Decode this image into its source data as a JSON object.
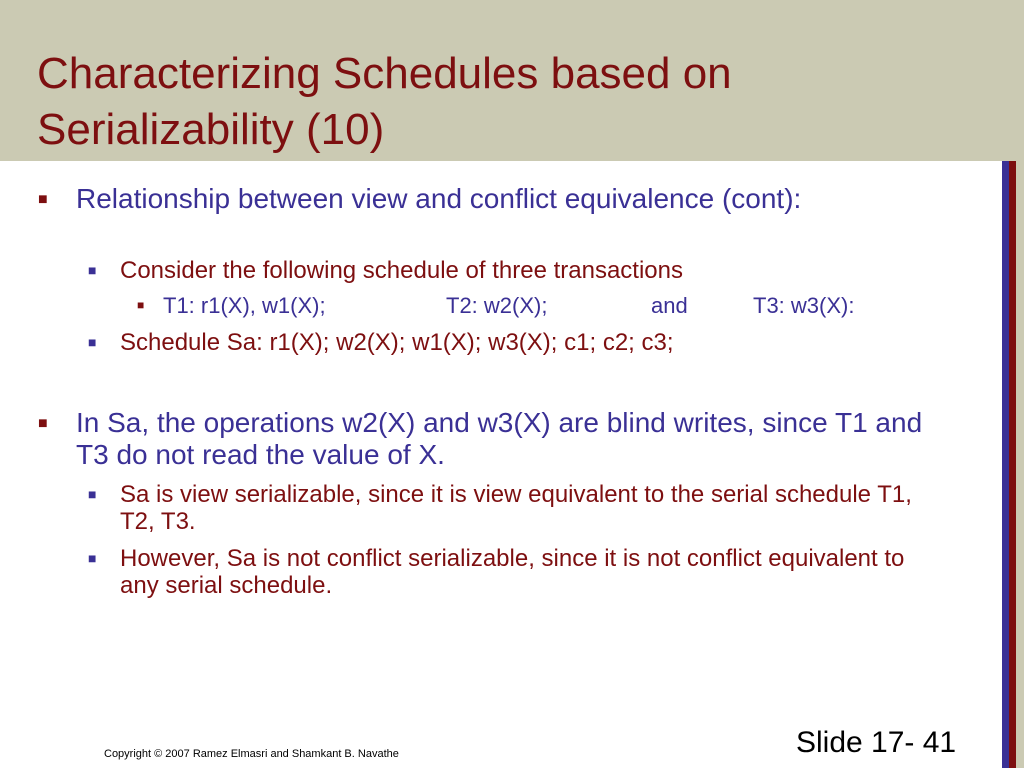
{
  "title": "Characterizing Schedules based on Serializability (10)",
  "bullets": {
    "b1": "Relationship between view and conflict equivalence (cont):",
    "b1_sub1": "Consider the following schedule of three transactions",
    "b1_sub1_sub": {
      "t1": "T1: r1(X), w1(X);",
      "t2": "T2: w2(X);",
      "and": "and",
      "t3": "T3: w3(X):"
    },
    "b1_sub2": "Schedule Sa: r1(X); w2(X); w1(X); w3(X); c1; c2; c3;",
    "b2": "In Sa, the operations w2(X) and w3(X) are blind writes, since T1 and T3 do not read the value of X.",
    "b2_sub1": "Sa is view serializable, since it is view equivalent to the serial schedule T1, T2, T3.",
    "b2_sub2": "However, Sa is not conflict serializable, since it is not conflict equivalent to any serial schedule."
  },
  "footer": {
    "copyright": "Copyright © 2007 Ramez Elmasri and Shamkant B. Navathe",
    "slide_number": "Slide 17- 41"
  },
  "colors": {
    "title_bar": "#cbcab3",
    "dark_red": "#7d0f10",
    "blue": "#3a3095"
  },
  "icons": {
    "bullet": "square-bullet-icon"
  }
}
